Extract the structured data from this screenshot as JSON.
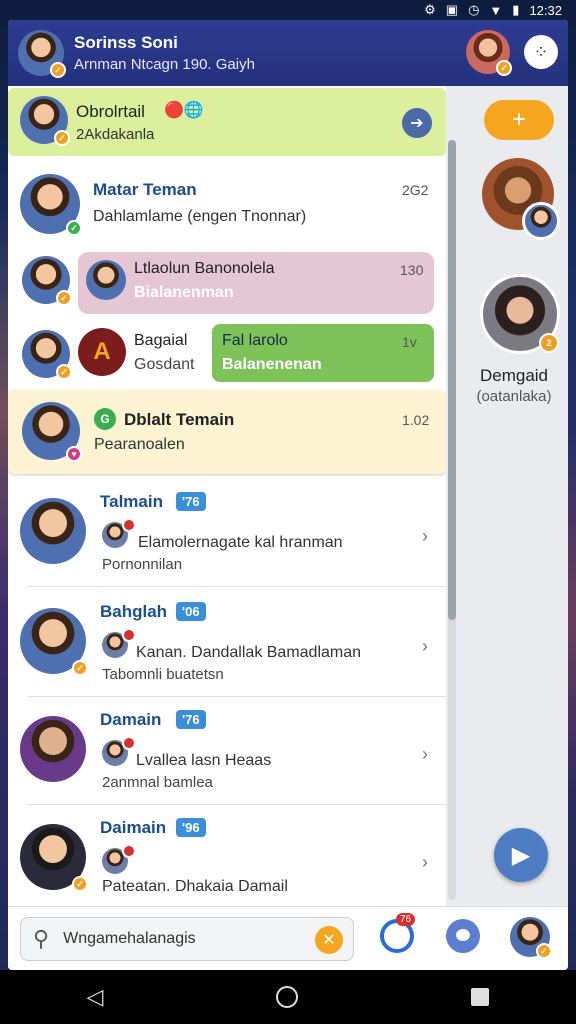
{
  "status_bar": {
    "time": "12:32"
  },
  "header": {
    "title": "Sorinss Soni",
    "subtitle": "Arnman Ntcagn 190. Gaiyh"
  },
  "chats": [
    {
      "name": "Obrolrtail",
      "preview": "2Akdakanla"
    },
    {
      "name": "Matar Teman",
      "preview": "Dahlamlame (engen Tnonnar)",
      "time": "2G2"
    },
    {
      "name": "Ltlaolun Banonolela",
      "preview": "Bialanenman",
      "time": "130"
    },
    {
      "name": "Bagaial",
      "preview": "Gosdant",
      "bubble_name": "Fal larolo",
      "bubble_preview": "Balanenenan",
      "time": "1v"
    },
    {
      "name": "Dblalt Temain",
      "preview": "Pearanoalen",
      "time": "1.02"
    },
    {
      "name": "Talmain",
      "tag": "'76",
      "preview": "Elamolernagate kal hranman",
      "sub": "Pornonnilan"
    },
    {
      "name": "Bahglah",
      "tag": "'06",
      "preview": "Kanan. Dandallak Bamadlaman",
      "sub": "Tabomnli buatetsn"
    },
    {
      "name": "Damain",
      "tag": "'76",
      "preview": "Lvallea lasn Heaas",
      "sub": "2anmnal bamlea"
    },
    {
      "name": "Daimain",
      "tag": "'96",
      "preview": "Pateatan. Dhakaia Damail",
      "sub": ""
    }
  ],
  "right_panel": {
    "name": "Demgaid",
    "sub": "(oatanlaka)"
  },
  "bottom_bar": {
    "search_placeholder": "Wngamehalanagis",
    "notif_count": "76"
  }
}
